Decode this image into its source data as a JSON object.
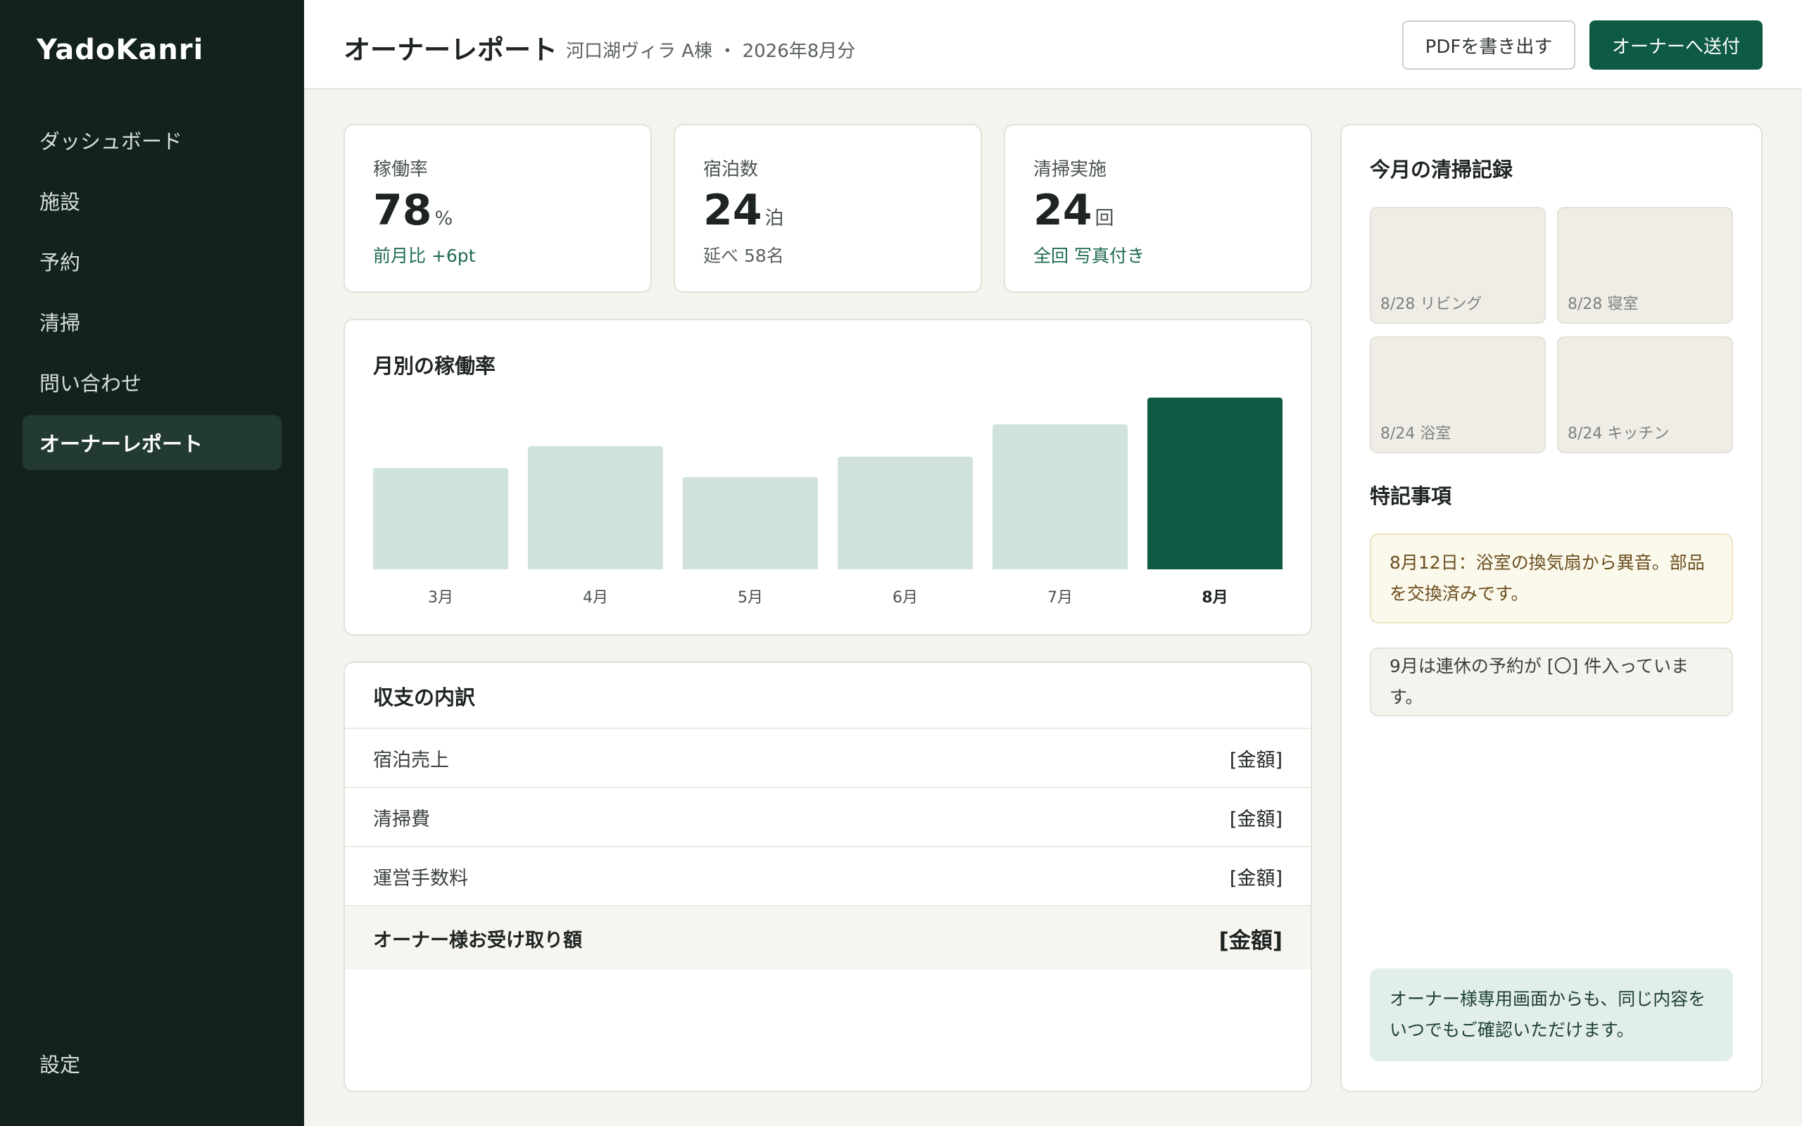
{
  "app": {
    "name": "YadoKanri"
  },
  "sidebar": {
    "items": [
      {
        "label": "ダッシュボード",
        "active": false
      },
      {
        "label": "施設",
        "active": false
      },
      {
        "label": "予約",
        "active": false
      },
      {
        "label": "清掃",
        "active": false
      },
      {
        "label": "問い合わせ",
        "active": false
      },
      {
        "label": "オーナーレポート",
        "active": true
      }
    ],
    "settings_label": "設定"
  },
  "header": {
    "title": "オーナーレポート",
    "subtitle": "河口湖ヴィラ A棟 ・ 2026年8月分",
    "export_label": "PDFを書き出す",
    "send_label": "オーナーへ送付"
  },
  "stats": [
    {
      "label": "稼働率",
      "value": "78",
      "unit": "%",
      "note": "前月比 +6pt",
      "note_color": "#1f6b52"
    },
    {
      "label": "宿泊数",
      "value": "24",
      "unit": "泊",
      "note": "延べ 58名",
      "note_color": "#5b625f"
    },
    {
      "label": "清掃実施",
      "value": "24",
      "unit": "回",
      "note": "全回 写真付き",
      "note_color": "#1f6b52"
    }
  ],
  "chart_title": "月別の稼働率",
  "chart_data": {
    "type": "bar",
    "title": "月別の稼働率",
    "categories": [
      "3月",
      "4月",
      "5月",
      "6月",
      "7月",
      "8月"
    ],
    "values": [
      46,
      56,
      42,
      51,
      66,
      78
    ],
    "ylim": [
      0,
      78
    ],
    "highlight": "8月",
    "bar_color": "#cfe3da",
    "highlight_color": "#0f5a45"
  },
  "finance": {
    "title": "収支の内訳",
    "rows": [
      {
        "label": "宿泊売上",
        "amount": "[金額]"
      },
      {
        "label": "清掃費",
        "amount": "[金額]"
      },
      {
        "label": "運営手数料",
        "amount": "[金額]"
      }
    ],
    "total": {
      "label": "オーナー様お受け取り額",
      "amount": "[金額]"
    }
  },
  "cleaning": {
    "title": "今月の清掃記録",
    "photos": [
      {
        "caption": "8/28 リビング"
      },
      {
        "caption": "8/28 寝室"
      },
      {
        "caption": "8/24 浴室"
      },
      {
        "caption": "8/24 キッチン"
      }
    ]
  },
  "remarks": {
    "title": "特記事項",
    "notes": [
      "8月12日：浴室の換気扇から異音。部品を交換済みです。",
      "9月は連休の予約が [〇] 件入っています。"
    ]
  },
  "footer_note": "オーナー様専用画面からも、同じ内容をいつでもご確認いただけます。"
}
